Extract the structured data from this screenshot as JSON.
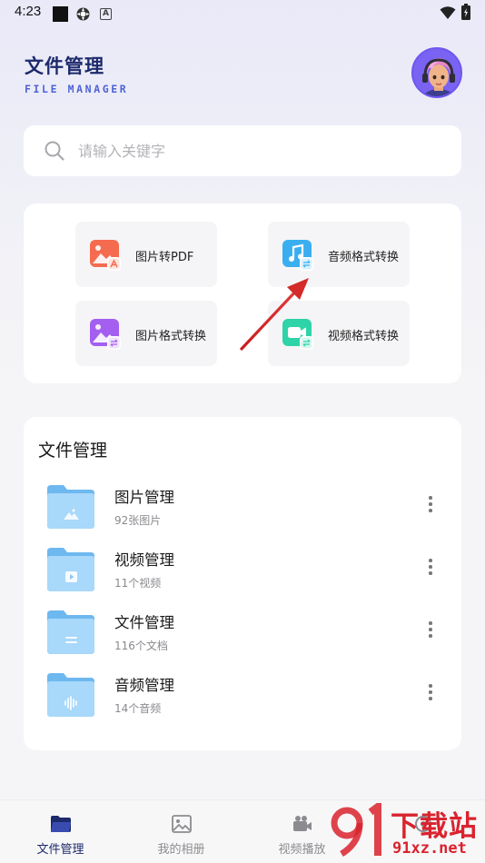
{
  "status_bar": {
    "time": "4:23"
  },
  "header": {
    "title": "文件管理",
    "subtitle": "FILE MANAGER"
  },
  "search": {
    "placeholder": "请输入关键字"
  },
  "tools": [
    {
      "label": "图片转PDF",
      "icon": "image-to-pdf-icon",
      "color": "#f56b4f"
    },
    {
      "label": "音频格式转换",
      "icon": "audio-convert-icon",
      "color": "#3aaef0"
    },
    {
      "label": "图片格式转换",
      "icon": "image-convert-icon",
      "color": "#a45ff0"
    },
    {
      "label": "视频格式转换",
      "icon": "video-convert-icon",
      "color": "#2fd3a8"
    }
  ],
  "files_section": {
    "title": "文件管理",
    "items": [
      {
        "name": "图片管理",
        "meta": "92张图片",
        "icon": "image-folder-icon"
      },
      {
        "name": "视频管理",
        "meta": "11个视频",
        "icon": "video-folder-icon"
      },
      {
        "name": "文件管理",
        "meta": "116个文档",
        "icon": "document-folder-icon"
      },
      {
        "name": "音频管理",
        "meta": "14个音频",
        "icon": "audio-folder-icon"
      }
    ]
  },
  "bottom_nav": [
    {
      "label": "文件管理",
      "icon": "folder-icon",
      "active": true
    },
    {
      "label": "我的相册",
      "icon": "photo-album-icon",
      "active": false
    },
    {
      "label": "视频播放",
      "icon": "video-camera-icon",
      "active": false
    },
    {
      "label": "",
      "icon": "settings-icon",
      "active": false
    }
  ],
  "watermark": {
    "text": "下载站",
    "url": "91xz.net"
  },
  "colors": {
    "accent": "#1d2a6b",
    "brand_blue": "#4e63d6",
    "arrow": "#d42a2a",
    "watermark": "#d9232e"
  }
}
